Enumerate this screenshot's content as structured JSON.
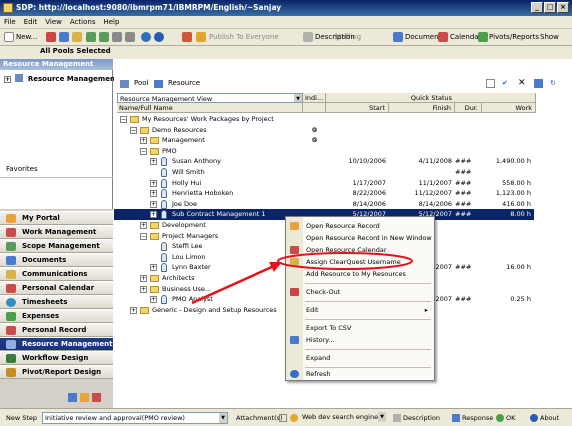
{
  "window": {
    "title": "SDP: http://localhost:9080/ibmrpm71/IBMRPM/English/~Sanjay",
    "min": "_",
    "max": "□",
    "close": "×"
  },
  "menu": [
    "File",
    "Edit",
    "View",
    "Actions",
    "Help"
  ],
  "toolbar": {
    "new_label": "New...",
    "publish_label": "Publish To Everyone",
    "staffing_label": "Staffing",
    "description_label": "Description",
    "document_label": "Document",
    "calendar_label": "Calendar",
    "pivots_label": "Pivots/Reports",
    "show_label": "Show"
  },
  "pool_label": "All Pools Selected",
  "left": {
    "header": "Resource Management",
    "tree_root": "Resource Management",
    "favorites": "Favorites",
    "nav": [
      "My Portal",
      "Work Management",
      "Scope Management",
      "Documents",
      "Communications",
      "Personal Calendar",
      "Timesheets",
      "Expenses",
      "Personal Record",
      "Resource Management",
      "Workflow Design",
      "Pivot/Report Design"
    ]
  },
  "right": {
    "pool_btn": "Pool",
    "resource_btn": "Resource",
    "view_label": "Resource Management View",
    "col_name": "Name/Full Name",
    "col_indi": "Indi...",
    "col_quick": "Quick Status",
    "col_start": "Start",
    "col_finish": "Finish",
    "col_dur": "Dur.",
    "col_work": "Work",
    "rows": [
      {
        "label": "My Resources' Work Packages by Project",
        "start": "",
        "finish": "",
        "dur": "",
        "work": ""
      },
      {
        "label": "Demo Resources",
        "start": "",
        "finish": "",
        "dur": "",
        "work": ""
      },
      {
        "label": "Management",
        "start": "",
        "finish": "",
        "dur": "",
        "work": ""
      },
      {
        "label": "PMO",
        "start": "",
        "finish": "",
        "dur": "",
        "work": ""
      },
      {
        "label": "Susan Anthony",
        "start": "10/10/2006",
        "finish": "4/11/2008",
        "dur": "###",
        "work": "1,490.00 h"
      },
      {
        "label": "Will Smith",
        "start": "",
        "finish": "",
        "dur": "###",
        "work": ""
      },
      {
        "label": "Holly Hui",
        "start": "1/17/2007",
        "finish": "11/1/2007",
        "dur": "###",
        "work": "558.00 h"
      },
      {
        "label": "Henrietta Hoboken",
        "start": "8/22/2006",
        "finish": "11/12/2007",
        "dur": "###",
        "work": "1,123.00 h"
      },
      {
        "label": "Joe Doe",
        "start": "8/14/2006",
        "finish": "8/14/2006",
        "dur": "###",
        "work": "416.00 h"
      },
      {
        "label": "Sub Contract Management 1",
        "start": "5/12/2007",
        "finish": "5/12/2007",
        "dur": "###",
        "work": "8.00 h"
      },
      {
        "label": "Development",
        "start": "",
        "finish": "",
        "dur": "",
        "work": ""
      },
      {
        "label": "Project Managers",
        "start": "",
        "finish": "",
        "dur": "",
        "work": ""
      },
      {
        "label": "Steffi Lee",
        "start": "",
        "finish": "",
        "dur": "",
        "work": ""
      },
      {
        "label": "Lou Limon",
        "start": "",
        "finish": "",
        "dur": "",
        "work": ""
      },
      {
        "label": "Lynn Baxter",
        "start": "",
        "finish": "2007",
        "dur": "###",
        "work": "16.00 h"
      },
      {
        "label": "Architects",
        "start": "",
        "finish": "",
        "dur": "",
        "work": ""
      },
      {
        "label": "Business Use...",
        "start": "",
        "finish": "",
        "dur": "",
        "work": ""
      },
      {
        "label": "PMO Analyst",
        "start": "",
        "finish": "2007",
        "dur": "###",
        "work": "0.25 h"
      },
      {
        "label": "Generic - Design and Setup Resources",
        "start": "",
        "finish": "",
        "dur": "",
        "work": ""
      }
    ]
  },
  "context_menu": [
    "Open Resource Record",
    "Open Resource Record in New Window",
    "Open Resource Calendar",
    "Assign ClearQuest Username",
    "Add Resource to My Resources",
    "Check-Out",
    "Edit",
    "Export To CSV",
    "History...",
    "Expand",
    "Refresh"
  ],
  "status": {
    "next_step_label": "New Step",
    "next_step_value": "Initiative review and approval(PMO review)",
    "attachments": "Attachment(s)",
    "search_value": "Web dev search engine",
    "description": "Description",
    "response": "Response",
    "ok": "OK",
    "about": "About"
  },
  "colors": {
    "highlight": "#0a246a",
    "annotation": "#e8101a",
    "title_bar": "#0a246a"
  }
}
